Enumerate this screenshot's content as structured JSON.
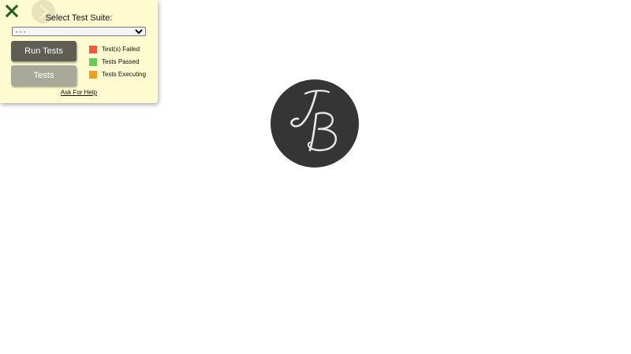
{
  "panel": {
    "close_icon": "close-icon",
    "suite_label": "Select Test Suite:",
    "suite_select": {
      "selected": "- - -"
    },
    "run_button_label": "Run Tests",
    "tests_button_label": "Tests",
    "legend": [
      {
        "label": "Test(s) Failed",
        "color": "#ee5a3c"
      },
      {
        "label": "Tests Passed",
        "color": "#66cc55"
      },
      {
        "label": "Tests Executing",
        "color": "#f0a020"
      }
    ],
    "help_link": "Ask For Help",
    "colors": {
      "panel_background": "#fdfbcf",
      "close_icon": "#1c5e1c",
      "run_button": "#5e5e54",
      "tests_button": "#a9a999"
    }
  },
  "logo": {
    "icon": "jb-monogram-logo",
    "background": "#353535",
    "foreground": "#e8e8e8"
  }
}
